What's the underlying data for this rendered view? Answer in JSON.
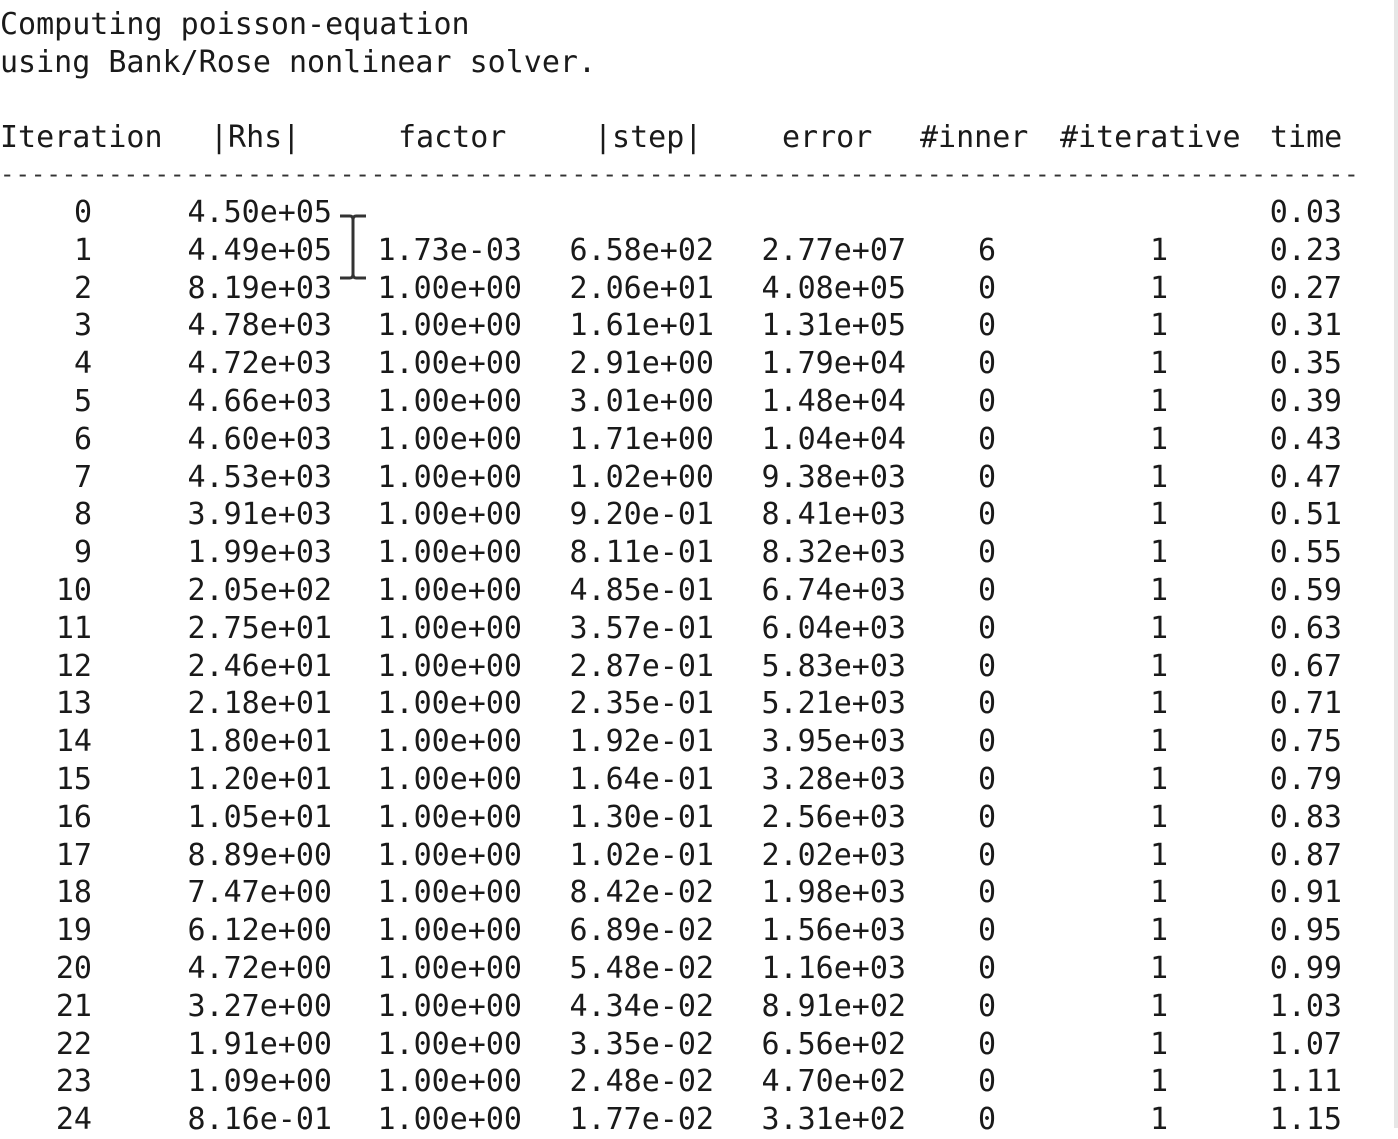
{
  "intro": {
    "line1": "Computing poisson-equation",
    "line2": "using Bank/Rose nonlinear solver."
  },
  "columns": {
    "iteration": "Iteration",
    "rhs": "|Rhs|",
    "factor": "factor",
    "step": "|step|",
    "error": "error",
    "inner": "#inner",
    "iterative": "#iterative",
    "time": "time"
  },
  "separator": "--------------------------------------------------------------------------------------------------------------",
  "rows": [
    [
      "0",
      "4.50e+05",
      "",
      "",
      "",
      "",
      "",
      "0.03"
    ],
    [
      "1",
      "4.49e+05",
      "1.73e-03",
      "6.58e+02",
      "2.77e+07",
      "6",
      "1",
      "0.23"
    ],
    [
      "2",
      "8.19e+03",
      "1.00e+00",
      "2.06e+01",
      "4.08e+05",
      "0",
      "1",
      "0.27"
    ],
    [
      "3",
      "4.78e+03",
      "1.00e+00",
      "1.61e+01",
      "1.31e+05",
      "0",
      "1",
      "0.31"
    ],
    [
      "4",
      "4.72e+03",
      "1.00e+00",
      "2.91e+00",
      "1.79e+04",
      "0",
      "1",
      "0.35"
    ],
    [
      "5",
      "4.66e+03",
      "1.00e+00",
      "3.01e+00",
      "1.48e+04",
      "0",
      "1",
      "0.39"
    ],
    [
      "6",
      "4.60e+03",
      "1.00e+00",
      "1.71e+00",
      "1.04e+04",
      "0",
      "1",
      "0.43"
    ],
    [
      "7",
      "4.53e+03",
      "1.00e+00",
      "1.02e+00",
      "9.38e+03",
      "0",
      "1",
      "0.47"
    ],
    [
      "8",
      "3.91e+03",
      "1.00e+00",
      "9.20e-01",
      "8.41e+03",
      "0",
      "1",
      "0.51"
    ],
    [
      "9",
      "1.99e+03",
      "1.00e+00",
      "8.11e-01",
      "8.32e+03",
      "0",
      "1",
      "0.55"
    ],
    [
      "10",
      "2.05e+02",
      "1.00e+00",
      "4.85e-01",
      "6.74e+03",
      "0",
      "1",
      "0.59"
    ],
    [
      "11",
      "2.75e+01",
      "1.00e+00",
      "3.57e-01",
      "6.04e+03",
      "0",
      "1",
      "0.63"
    ],
    [
      "12",
      "2.46e+01",
      "1.00e+00",
      "2.87e-01",
      "5.83e+03",
      "0",
      "1",
      "0.67"
    ],
    [
      "13",
      "2.18e+01",
      "1.00e+00",
      "2.35e-01",
      "5.21e+03",
      "0",
      "1",
      "0.71"
    ],
    [
      "14",
      "1.80e+01",
      "1.00e+00",
      "1.92e-01",
      "3.95e+03",
      "0",
      "1",
      "0.75"
    ],
    [
      "15",
      "1.20e+01",
      "1.00e+00",
      "1.64e-01",
      "3.28e+03",
      "0",
      "1",
      "0.79"
    ],
    [
      "16",
      "1.05e+01",
      "1.00e+00",
      "1.30e-01",
      "2.56e+03",
      "0",
      "1",
      "0.83"
    ],
    [
      "17",
      "8.89e+00",
      "1.00e+00",
      "1.02e-01",
      "2.02e+03",
      "0",
      "1",
      "0.87"
    ],
    [
      "18",
      "7.47e+00",
      "1.00e+00",
      "8.42e-02",
      "1.98e+03",
      "0",
      "1",
      "0.91"
    ],
    [
      "19",
      "6.12e+00",
      "1.00e+00",
      "6.89e-02",
      "1.56e+03",
      "0",
      "1",
      "0.95"
    ],
    [
      "20",
      "4.72e+00",
      "1.00e+00",
      "5.48e-02",
      "1.16e+03",
      "0",
      "1",
      "0.99"
    ],
    [
      "21",
      "3.27e+00",
      "1.00e+00",
      "4.34e-02",
      "8.91e+02",
      "0",
      "1",
      "1.03"
    ],
    [
      "22",
      "1.91e+00",
      "1.00e+00",
      "3.35e-02",
      "6.56e+02",
      "0",
      "1",
      "1.07"
    ],
    [
      "23",
      "1.09e+00",
      "1.00e+00",
      "2.48e-02",
      "4.70e+02",
      "0",
      "1",
      "1.11"
    ],
    [
      "24",
      "8.16e-01",
      "1.00e+00",
      "1.77e-02",
      "3.31e+02",
      "0",
      "1",
      "1.15"
    ]
  ],
  "icons": {
    "cursor": "text-cursor-icon"
  }
}
